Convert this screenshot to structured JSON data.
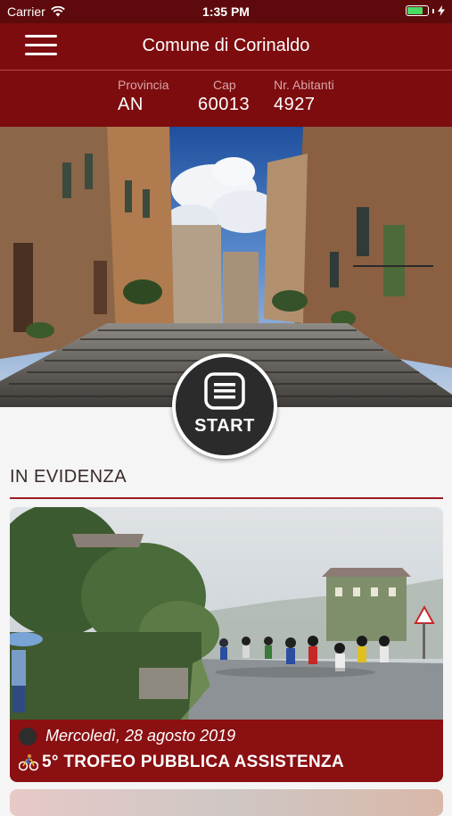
{
  "status_bar": {
    "carrier": "Carrier",
    "time": "1:35 PM",
    "battery_level": 0.8
  },
  "header": {
    "title": "Comune di Corinaldo"
  },
  "info": {
    "provincia_label": "Provincia",
    "provincia_value": "AN",
    "cap_label": "Cap",
    "cap_value": "60013",
    "abitanti_label": "Nr. Abitanti",
    "abitanti_value": "4927"
  },
  "start_button": {
    "label": "START"
  },
  "featured": {
    "section_title": "IN EVIDENZA",
    "items": [
      {
        "date": "Mercoledì, 28 agosto 2019",
        "title": "5° TROFEO PUBBLICA ASSISTENZA",
        "icon": "cyclist-icon"
      }
    ]
  },
  "colors": {
    "primary": "#7d0c0f",
    "status_bar": "#5e0a0c",
    "caption": "#8a1012",
    "accent_line": "#9c1c1f"
  }
}
